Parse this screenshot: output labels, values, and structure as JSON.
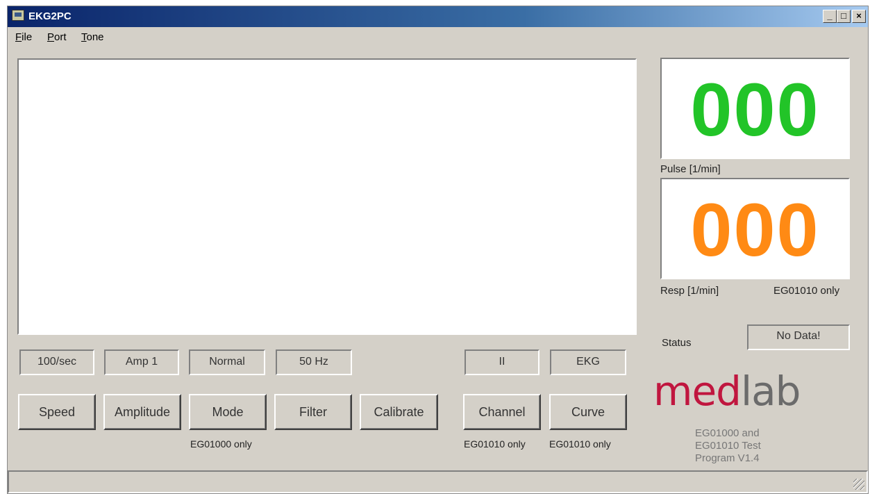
{
  "window": {
    "title": "EKG2PC"
  },
  "menu": [
    {
      "accel": "F",
      "rest": "ile"
    },
    {
      "accel": "P",
      "rest": "ort"
    },
    {
      "accel": "T",
      "rest": "one"
    }
  ],
  "pulse": {
    "value": "000",
    "label": "Pulse [1/min]",
    "color": "#22c428"
  },
  "resp": {
    "value": "000",
    "label": "Resp [1/min]",
    "note": "EG01010 only",
    "color": "#ff8a14"
  },
  "status": {
    "label": "Status",
    "value": "No Data!"
  },
  "settings": {
    "speed": "100/sec",
    "amplitude": "Amp 1",
    "mode": "Normal",
    "filter": "50 Hz",
    "channel": "II",
    "curve": "EKG"
  },
  "buttons": {
    "speed": "Speed",
    "amplitude": "Amplitude",
    "mode": "Mode",
    "filter": "Filter",
    "calibrate": "Calibrate",
    "channel": "Channel",
    "curve": "Curve"
  },
  "notes": {
    "mode": "EG01000 only",
    "channel": "EG01010 only",
    "curve": "EG01010 only"
  },
  "logo": {
    "part1": "med",
    "part2": "lab"
  },
  "version_text": "EG01000 and EG01010 Test Program V1.4"
}
